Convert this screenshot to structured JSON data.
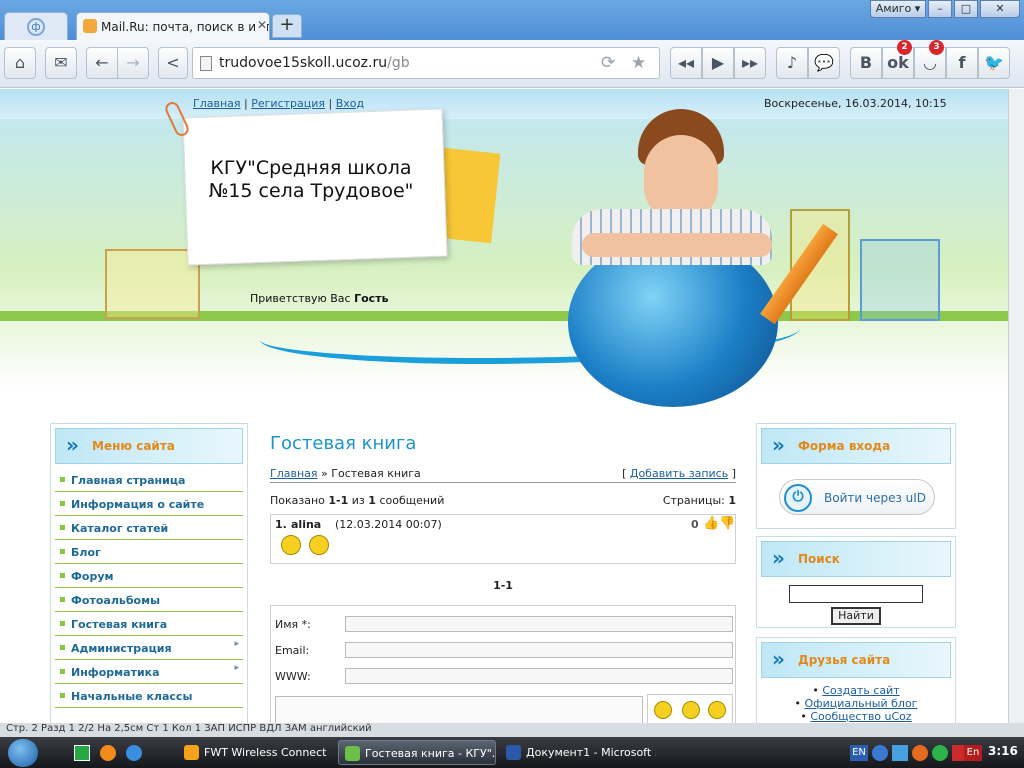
{
  "browser": {
    "tabs": [
      {
        "label": "Mail.Ru: почта, поиск в интер"
      }
    ],
    "new_tab": "+",
    "profile_button": "Амиго ▾",
    "window_controls": {
      "minimize": "–",
      "maximize": "□",
      "close": "✕"
    },
    "address_host": "trudovoe15skoll.ucoz.ru",
    "address_path": "/gb",
    "badges": {
      "ok": "2",
      "smile": "3"
    }
  },
  "site": {
    "top_links": {
      "home": "Главная",
      "register": "Регистрация",
      "login": "Вход",
      "sep": "|"
    },
    "date": "Воскресенье, 16.03.2014, 10:15",
    "title": "КГУ\"Средняя школа №15 села Трудовое\"",
    "welcome_prefix": "Приветствую Вас",
    "welcome_user": "Гость"
  },
  "menu": {
    "title": "Меню сайта",
    "items": [
      {
        "label": "Главная страница"
      },
      {
        "label": "Информация о сайте"
      },
      {
        "label": "Каталог статей"
      },
      {
        "label": "Блог"
      },
      {
        "label": "Форум"
      },
      {
        "label": "Фотоальбомы"
      },
      {
        "label": "Гостевая книга"
      },
      {
        "label": "Администрация"
      },
      {
        "label": "Информатика"
      },
      {
        "label": "Начальные классы"
      }
    ]
  },
  "guestbook": {
    "title": "Гостевая книга",
    "crumb_home": "Главная",
    "crumb_sep": "»",
    "crumb_current": "Гостевая книга",
    "add_record": "Добавить запись",
    "shown_prefix": "Показано",
    "shown_range": "1-1",
    "shown_of": "из",
    "shown_total": "1",
    "shown_suffix": "сообщений",
    "pages_label": "Страницы:",
    "pages_value": "1",
    "entry": {
      "num": "1.",
      "name": "alina",
      "date": "(12.03.2014 00:07)",
      "rating": "0"
    },
    "pager": "1-1",
    "form": {
      "name_label": "Имя *:",
      "email_label": "Email:",
      "www_label": "WWW:"
    }
  },
  "login_block": {
    "title": "Форма входа",
    "uid_label": "Войти через uID"
  },
  "search_block": {
    "title": "Поиск",
    "button": "Найти"
  },
  "friends_block": {
    "title": "Друзья сайта",
    "links": [
      "Создать сайт",
      "Официальный блог",
      "Сообщество uCoz"
    ]
  },
  "statusbar": {
    "text": "Стр. 2     Разд 1     2/2     На 2,5см     Ст 1     Кол 1          ЗАП   ИСПР   ВДЛ   ЗАМ   английский"
  },
  "taskbar": {
    "items": [
      {
        "label": "FWT Wireless Connect"
      },
      {
        "label": "Гостевая книга - КГУ\"..."
      },
      {
        "label": "Документ1 - Microsoft ..."
      }
    ],
    "lang_en": "EN",
    "lang_en2": "En",
    "clock": "3:16"
  }
}
